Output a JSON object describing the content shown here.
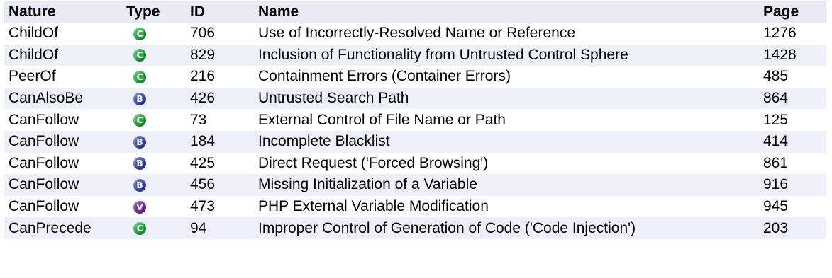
{
  "headers": {
    "nature": "Nature",
    "type": "Type",
    "id": "ID",
    "name": "Name",
    "page": "Page"
  },
  "colors": {
    "class": "#2ea84a",
    "base": "#3f4fa6",
    "variant": "#7b2d9e",
    "header_bg": "#e8eaf4",
    "alt_row_bg": "#edf0f8"
  },
  "rows": [
    {
      "nature": "ChildOf",
      "type": "C",
      "id": "706",
      "name": "Use of Incorrectly-Resolved Name or Reference",
      "page": "1276"
    },
    {
      "nature": "ChildOf",
      "type": "C",
      "id": "829",
      "name": "Inclusion of Functionality from Untrusted Control Sphere",
      "page": "1428"
    },
    {
      "nature": "PeerOf",
      "type": "C",
      "id": "216",
      "name": "Containment Errors (Container Errors)",
      "page": "485"
    },
    {
      "nature": "CanAlsoBe",
      "type": "B",
      "id": "426",
      "name": "Untrusted Search Path",
      "page": "864"
    },
    {
      "nature": "CanFollow",
      "type": "C",
      "id": "73",
      "name": "External Control of File Name or Path",
      "page": "125"
    },
    {
      "nature": "CanFollow",
      "type": "B",
      "id": "184",
      "name": "Incomplete Blacklist",
      "page": "414"
    },
    {
      "nature": "CanFollow",
      "type": "B",
      "id": "425",
      "name": "Direct Request ('Forced Browsing')",
      "page": "861"
    },
    {
      "nature": "CanFollow",
      "type": "B",
      "id": "456",
      "name": "Missing Initialization of a Variable",
      "page": "916"
    },
    {
      "nature": "CanFollow",
      "type": "V",
      "id": "473",
      "name": "PHP External Variable Modification",
      "page": "945"
    },
    {
      "nature": "CanPrecede",
      "type": "C",
      "id": "94",
      "name": "Improper Control of Generation of Code ('Code Injection')",
      "page": "203"
    }
  ]
}
